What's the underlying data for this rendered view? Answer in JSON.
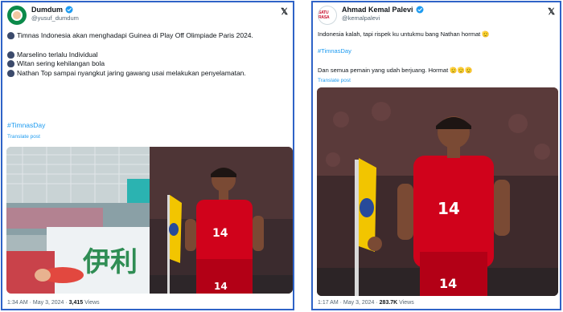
{
  "left_post": {
    "display_name": "Dumdum",
    "handle": "@yusuf_dumdum",
    "text_line_1": "Timnas Indonesia akan menghadapi Guinea di Play Off Olimpiade Paris 2024.",
    "bullet_1": "Marselino terlalu Individual",
    "bullet_2": "Witan sering kehilangan bola",
    "bullet_3": "Nathan Top sampai nyangkut jaring gawang usai melakukan penyelamatan.",
    "hashtag": "#TimnasDay",
    "translate": "Translate post",
    "timestamp": "1:34 AM · May 3, 2024 · ",
    "views_count": "3,415",
    "views_label": " Views",
    "ad_text": "伊利",
    "jersey_number": "14"
  },
  "right_post": {
    "display_name": "Ahmad Kemal Palevi",
    "handle": "@kemalpalevi",
    "avatar_text": "SATU RASA",
    "text_line_1": "Indonesia kalah, tapi rispek ku untukmu bang Nathan hormat 🫡",
    "hashtag": "#TimnasDay",
    "text_line_2": "Dan semua pemain yang udah berjuang. Hormat 🫡🫡🫡",
    "translate": "Translate post",
    "timestamp": "1:17 AM · May 3, 2024 · ",
    "views_count": "283.7K",
    "views_label": " Views",
    "jersey_number": "14"
  },
  "icons": {
    "verified": "verified-badge-icon",
    "platform": "x-logo-icon"
  },
  "colors": {
    "card_border": "#2f63c7",
    "link": "#1d9bf0",
    "jersey_red": "#d0021b",
    "corner_flag_yellow": "#f2c500"
  }
}
